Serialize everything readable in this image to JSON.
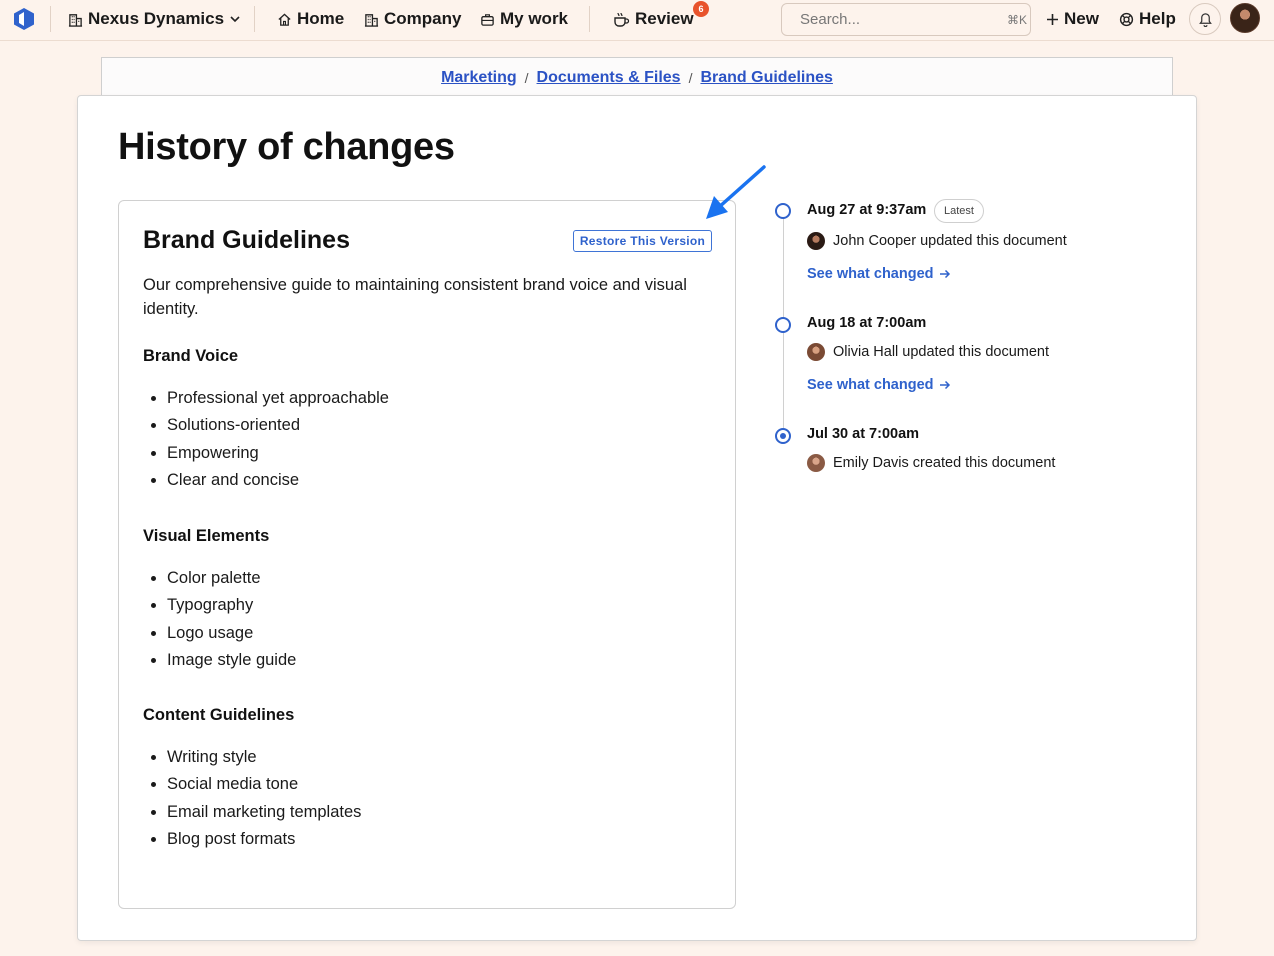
{
  "nav": {
    "org_name": "Nexus Dynamics",
    "items": [
      {
        "label": "Home"
      },
      {
        "label": "Company"
      },
      {
        "label": "My work"
      },
      {
        "label": "Review"
      }
    ],
    "review_badge": "6",
    "search_placeholder": "Search...",
    "search_shortcut": "⌘K",
    "new_label": "New",
    "help_label": "Help"
  },
  "breadcrumb": [
    "Marketing",
    "Documents & Files",
    "Brand Guidelines"
  ],
  "page": {
    "title": "History of changes"
  },
  "document": {
    "title": "Brand Guidelines",
    "restore_label": "Restore This Version",
    "description": "Our comprehensive guide to maintaining consistent brand voice and visual identity.",
    "sections": [
      {
        "heading": "Brand Voice",
        "items": [
          "Professional yet approachable",
          "Solutions-oriented",
          "Empowering",
          "Clear and concise"
        ]
      },
      {
        "heading": "Visual Elements",
        "items": [
          "Color palette",
          "Typography",
          "Logo usage",
          "Image style guide"
        ]
      },
      {
        "heading": "Content Guidelines",
        "items": [
          "Writing style",
          "Social media tone",
          "Email marketing templates",
          "Blog post formats"
        ]
      }
    ]
  },
  "timeline": [
    {
      "date": "Aug 27 at 9:37am",
      "badge": "Latest",
      "person": "John Cooper",
      "action": "updated this document",
      "link": "See what changed"
    },
    {
      "date": "Aug 18 at 7:00am",
      "person": "Olivia Hall",
      "action": "updated this document",
      "link": "See what changed"
    },
    {
      "date": "Jul 30 at 7:00am",
      "person": "Emily Davis",
      "action": "created this document"
    }
  ],
  "colors": {
    "accent": "#2f62cc",
    "page_bg": "#fdf3ec",
    "badge": "#e8532c"
  }
}
